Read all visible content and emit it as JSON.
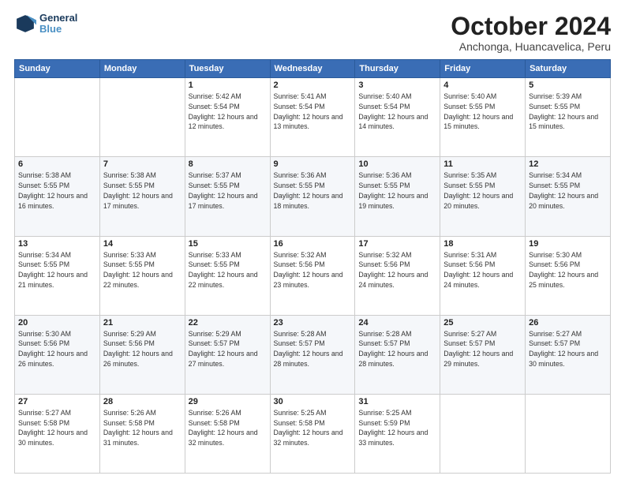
{
  "logo": {
    "line1": "General",
    "line2": "Blue"
  },
  "title": "October 2024",
  "subtitle": "Anchonga, Huancavelica, Peru",
  "headers": [
    "Sunday",
    "Monday",
    "Tuesday",
    "Wednesday",
    "Thursday",
    "Friday",
    "Saturday"
  ],
  "weeks": [
    [
      {
        "day": "",
        "info": ""
      },
      {
        "day": "",
        "info": ""
      },
      {
        "day": "1",
        "info": "Sunrise: 5:42 AM\nSunset: 5:54 PM\nDaylight: 12 hours and 12 minutes."
      },
      {
        "day": "2",
        "info": "Sunrise: 5:41 AM\nSunset: 5:54 PM\nDaylight: 12 hours and 13 minutes."
      },
      {
        "day": "3",
        "info": "Sunrise: 5:40 AM\nSunset: 5:54 PM\nDaylight: 12 hours and 14 minutes."
      },
      {
        "day": "4",
        "info": "Sunrise: 5:40 AM\nSunset: 5:55 PM\nDaylight: 12 hours and 15 minutes."
      },
      {
        "day": "5",
        "info": "Sunrise: 5:39 AM\nSunset: 5:55 PM\nDaylight: 12 hours and 15 minutes."
      }
    ],
    [
      {
        "day": "6",
        "info": "Sunrise: 5:38 AM\nSunset: 5:55 PM\nDaylight: 12 hours and 16 minutes."
      },
      {
        "day": "7",
        "info": "Sunrise: 5:38 AM\nSunset: 5:55 PM\nDaylight: 12 hours and 17 minutes."
      },
      {
        "day": "8",
        "info": "Sunrise: 5:37 AM\nSunset: 5:55 PM\nDaylight: 12 hours and 17 minutes."
      },
      {
        "day": "9",
        "info": "Sunrise: 5:36 AM\nSunset: 5:55 PM\nDaylight: 12 hours and 18 minutes."
      },
      {
        "day": "10",
        "info": "Sunrise: 5:36 AM\nSunset: 5:55 PM\nDaylight: 12 hours and 19 minutes."
      },
      {
        "day": "11",
        "info": "Sunrise: 5:35 AM\nSunset: 5:55 PM\nDaylight: 12 hours and 20 minutes."
      },
      {
        "day": "12",
        "info": "Sunrise: 5:34 AM\nSunset: 5:55 PM\nDaylight: 12 hours and 20 minutes."
      }
    ],
    [
      {
        "day": "13",
        "info": "Sunrise: 5:34 AM\nSunset: 5:55 PM\nDaylight: 12 hours and 21 minutes."
      },
      {
        "day": "14",
        "info": "Sunrise: 5:33 AM\nSunset: 5:55 PM\nDaylight: 12 hours and 22 minutes."
      },
      {
        "day": "15",
        "info": "Sunrise: 5:33 AM\nSunset: 5:55 PM\nDaylight: 12 hours and 22 minutes."
      },
      {
        "day": "16",
        "info": "Sunrise: 5:32 AM\nSunset: 5:56 PM\nDaylight: 12 hours and 23 minutes."
      },
      {
        "day": "17",
        "info": "Sunrise: 5:32 AM\nSunset: 5:56 PM\nDaylight: 12 hours and 24 minutes."
      },
      {
        "day": "18",
        "info": "Sunrise: 5:31 AM\nSunset: 5:56 PM\nDaylight: 12 hours and 24 minutes."
      },
      {
        "day": "19",
        "info": "Sunrise: 5:30 AM\nSunset: 5:56 PM\nDaylight: 12 hours and 25 minutes."
      }
    ],
    [
      {
        "day": "20",
        "info": "Sunrise: 5:30 AM\nSunset: 5:56 PM\nDaylight: 12 hours and 26 minutes."
      },
      {
        "day": "21",
        "info": "Sunrise: 5:29 AM\nSunset: 5:56 PM\nDaylight: 12 hours and 26 minutes."
      },
      {
        "day": "22",
        "info": "Sunrise: 5:29 AM\nSunset: 5:57 PM\nDaylight: 12 hours and 27 minutes."
      },
      {
        "day": "23",
        "info": "Sunrise: 5:28 AM\nSunset: 5:57 PM\nDaylight: 12 hours and 28 minutes."
      },
      {
        "day": "24",
        "info": "Sunrise: 5:28 AM\nSunset: 5:57 PM\nDaylight: 12 hours and 28 minutes."
      },
      {
        "day": "25",
        "info": "Sunrise: 5:27 AM\nSunset: 5:57 PM\nDaylight: 12 hours and 29 minutes."
      },
      {
        "day": "26",
        "info": "Sunrise: 5:27 AM\nSunset: 5:57 PM\nDaylight: 12 hours and 30 minutes."
      }
    ],
    [
      {
        "day": "27",
        "info": "Sunrise: 5:27 AM\nSunset: 5:58 PM\nDaylight: 12 hours and 30 minutes."
      },
      {
        "day": "28",
        "info": "Sunrise: 5:26 AM\nSunset: 5:58 PM\nDaylight: 12 hours and 31 minutes."
      },
      {
        "day": "29",
        "info": "Sunrise: 5:26 AM\nSunset: 5:58 PM\nDaylight: 12 hours and 32 minutes."
      },
      {
        "day": "30",
        "info": "Sunrise: 5:25 AM\nSunset: 5:58 PM\nDaylight: 12 hours and 32 minutes."
      },
      {
        "day": "31",
        "info": "Sunrise: 5:25 AM\nSunset: 5:59 PM\nDaylight: 12 hours and 33 minutes."
      },
      {
        "day": "",
        "info": ""
      },
      {
        "day": "",
        "info": ""
      }
    ]
  ]
}
